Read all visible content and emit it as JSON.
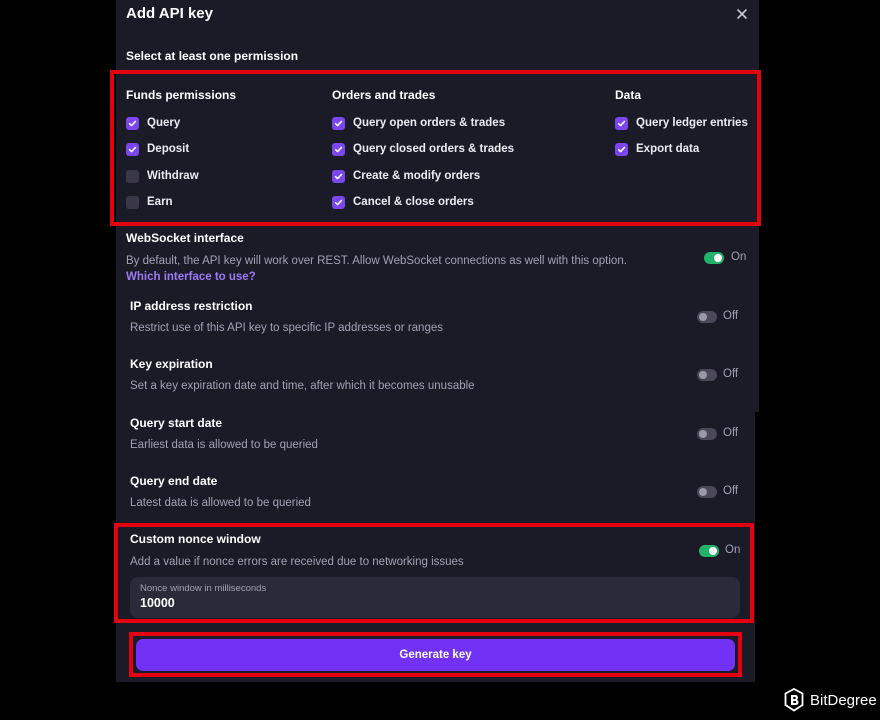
{
  "dialog": {
    "title": "Add API key",
    "permissions_heading": "Select at least one permission"
  },
  "permissions": {
    "funds": {
      "title": "Funds permissions",
      "items": [
        {
          "label": "Query",
          "checked": true
        },
        {
          "label": "Deposit",
          "checked": true
        },
        {
          "label": "Withdraw",
          "checked": false
        },
        {
          "label": "Earn",
          "checked": false
        }
      ]
    },
    "orders": {
      "title": "Orders and trades",
      "items": [
        {
          "label": "Query open orders & trades",
          "checked": true
        },
        {
          "label": "Query closed orders & trades",
          "checked": true
        },
        {
          "label": "Create & modify orders",
          "checked": true
        },
        {
          "label": "Cancel & close orders",
          "checked": true
        }
      ]
    },
    "data": {
      "title": "Data",
      "items": [
        {
          "label": "Query ledger entries",
          "checked": true
        },
        {
          "label": "Export data",
          "checked": true
        }
      ]
    }
  },
  "settings": {
    "websocket": {
      "title": "WebSocket interface",
      "desc": "By default, the API key will work over REST. Allow WebSocket connections as well with this option.",
      "link": "Which interface to use?",
      "state": "On"
    },
    "ip": {
      "title": "IP address restriction",
      "desc": "Restrict use of this API key to specific IP addresses or ranges",
      "state": "Off"
    },
    "expiration": {
      "title": "Key expiration",
      "desc": "Set a key expiration date and time, after which it becomes unusable",
      "state": "Off"
    },
    "start": {
      "title": "Query start date",
      "desc": "Earliest data is allowed to be queried",
      "state": "Off"
    },
    "end": {
      "title": "Query end date",
      "desc": "Latest data is allowed to be queried",
      "state": "Off"
    },
    "nonce": {
      "title": "Custom nonce window",
      "desc": "Add a value if nonce errors are received due to networking issues",
      "state": "On",
      "field_label": "Nonce window in milliseconds",
      "field_value": "10000"
    }
  },
  "actions": {
    "generate_label": "Generate key"
  },
  "watermark": {
    "text": "BitDegree"
  },
  "colors": {
    "accent": "#7132f5",
    "checkbox_on": "#7b46f0",
    "toggle_on": "#22b36b",
    "highlight": "#e3000f",
    "panel": "#1b1a27"
  },
  "icons": {
    "close": "close-icon",
    "check": "check-icon",
    "logo": "bitdegree-logo-icon"
  }
}
